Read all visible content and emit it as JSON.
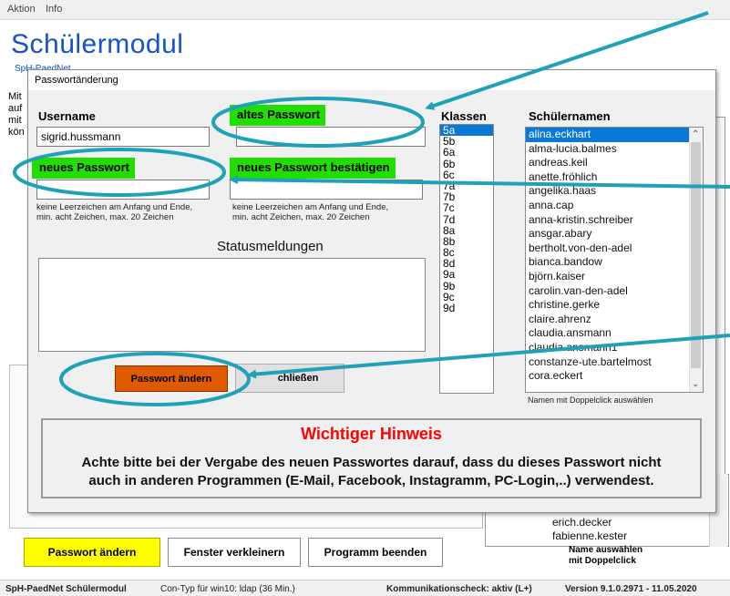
{
  "menu": [
    "Aktion",
    "Info"
  ],
  "app": {
    "title": "Schülermodul",
    "subtitle": "SpH-PaedNet"
  },
  "background": {
    "left_text": [
      "Mit",
      "auf",
      "mit",
      "kön"
    ],
    "bg_names": [
      "erich.decker",
      "fabienne.kester"
    ],
    "name_hint": [
      "Name auswählen",
      "mit Doppelclick"
    ],
    "buttons": {
      "change": "Passwort ändern",
      "shrink": "Fenster verkleinern",
      "quit": "Programm beenden"
    }
  },
  "statusbar": {
    "app": "SpH-PaedNet Schülermodul",
    "con": "Con-Typ für win10: ldap  (36 Min.)",
    "check": "Kommunikationscheck: aktiv (L+)",
    "version": "Version 9.1.0.2971 - 11.05.2020"
  },
  "dialog": {
    "title": "Passwortänderung",
    "username_label": "Username",
    "username_value": "sigrid.hussmann",
    "old_pw_label": "altes Passwort",
    "new_pw_label": "neues Passwort",
    "confirm_pw_label": "neues Passwort bestätigen",
    "pw_hint_1": "keine Leerzeichen am Anfang und Ende,",
    "pw_hint_2": "min. acht Zeichen,  max. 20 Zeichen",
    "status_label": "Statusmeldungen",
    "change_button": "Passwort ändern",
    "close_button": "chließen",
    "classes_label": "Klassen",
    "classes": [
      "5a",
      "5b",
      "6a",
      "6b",
      "6c",
      "7a",
      "7b",
      "7c",
      "7d",
      "8a",
      "8b",
      "8c",
      "8d",
      "9a",
      "9b",
      "9c",
      "9d"
    ],
    "selected_class": "5a",
    "names_label": "Schülernamen",
    "names": [
      "alina.eckhart",
      "alma-lucia.balmes",
      "andreas.keil",
      "anette.fröhlich",
      "angelika.haas",
      "anna.cap",
      "anna-kristin.schreiber",
      "ansgar.abary",
      "bertholt.von-den-adel",
      "bianca.bandow",
      "björn.kaiser",
      "carolin.van-den-adel",
      "christine.gerke",
      "claire.ahrenz",
      "claudia.ansmann",
      "claudia.ansmann1",
      "constanze-ute.bartelmost",
      "cora.eckert"
    ],
    "selected_name": "alina.eckhart",
    "names_hint": "Namen mit Doppelclick auswählen",
    "warning_title": "Wichtiger Hinweis",
    "warning_line1": "Achte bitte bei der Vergabe des neuen Passwortes darauf, dass du dieses Passwort nicht",
    "warning_line2": "auch in anderen  Programmen (E-Mail, Facebook, Instagramm, PC-Login,..) verwendest."
  },
  "colors": {
    "accent_green": "#22dd00",
    "change_button": "#e05a00",
    "annotation": "#1fa2b8",
    "warning_red": "#ff0000",
    "title_blue": "#1453c8"
  }
}
